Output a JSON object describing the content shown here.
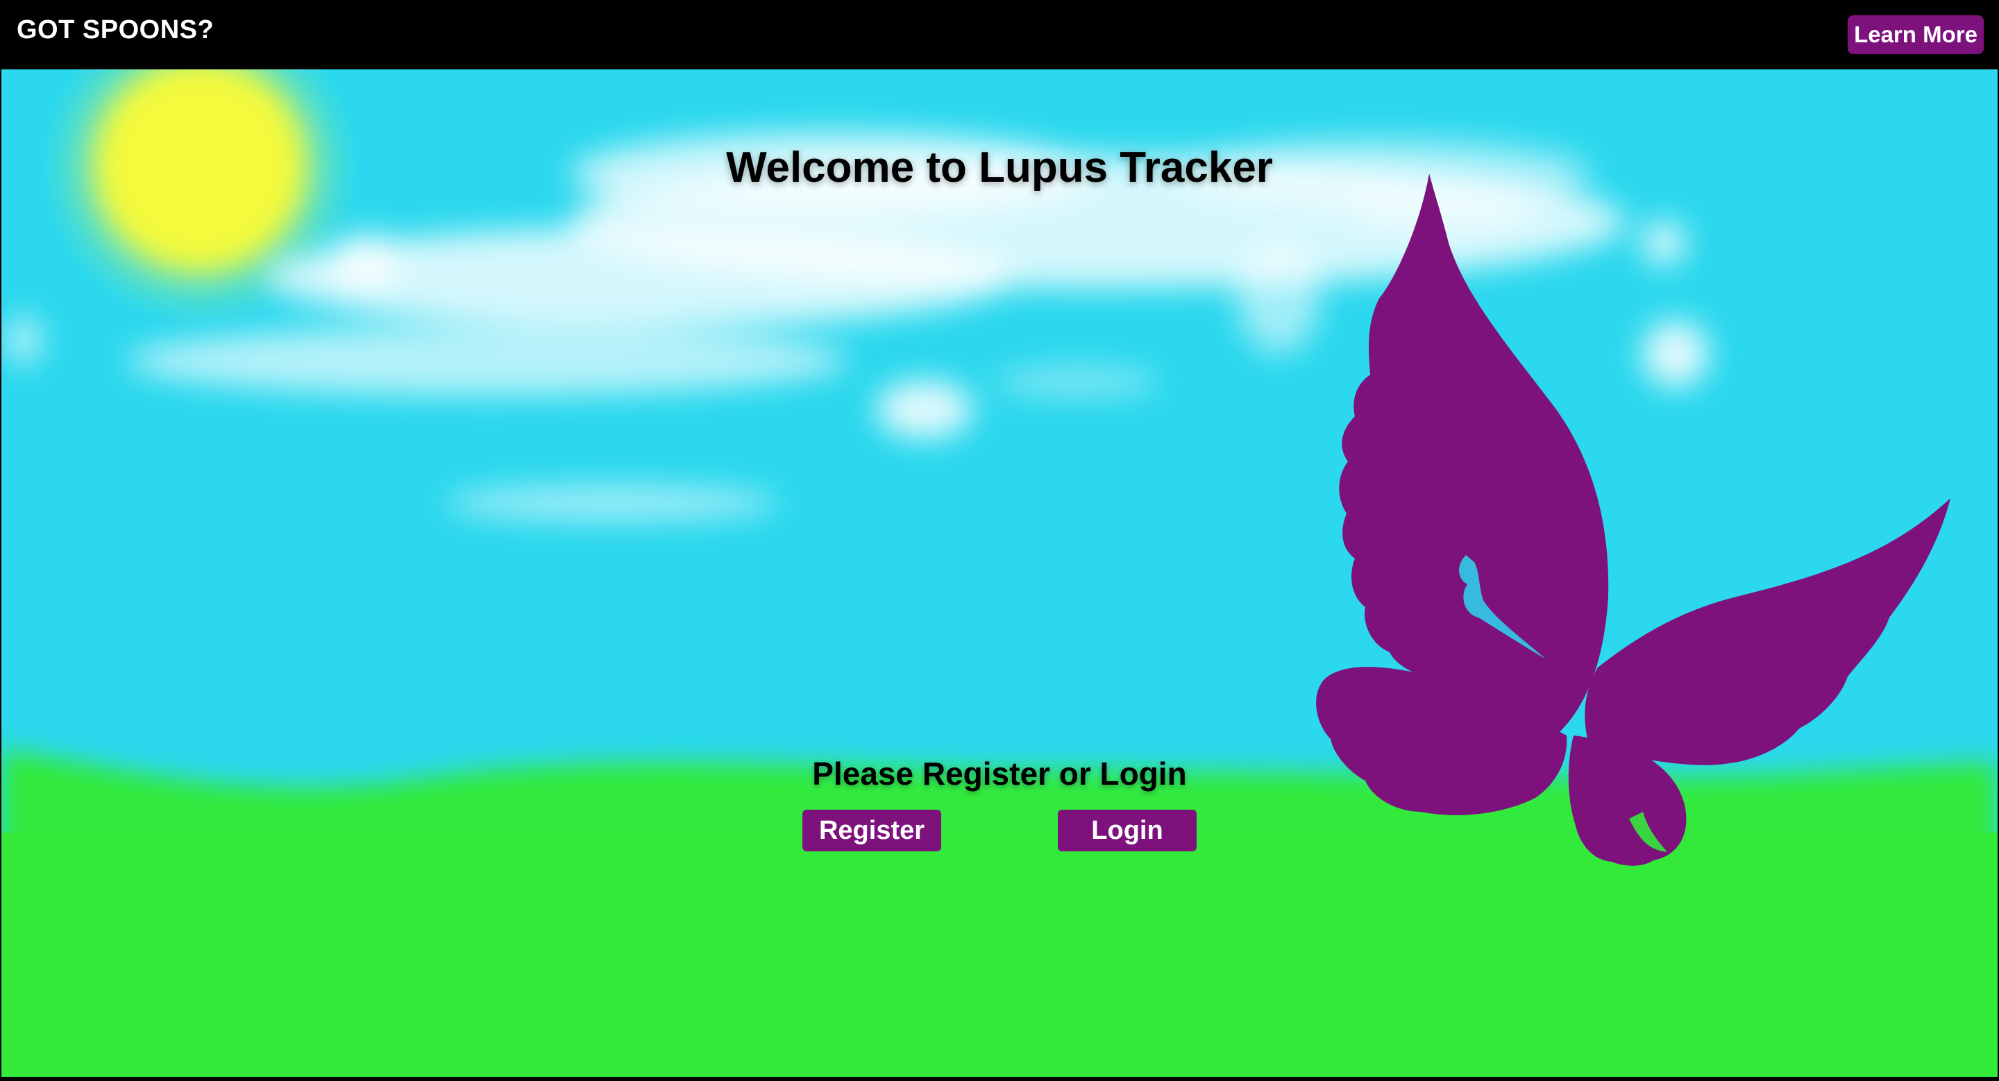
{
  "navbar": {
    "brand": "GOT SPOONS?",
    "learn_more_label": "Learn More"
  },
  "hero": {
    "title": "Welcome to Lupus Tracker",
    "prompt": "Please Register or Login",
    "register_label": "Register",
    "login_label": "Login",
    "illustration": [
      "sun",
      "clouds",
      "butterfly",
      "grass"
    ]
  },
  "colors": {
    "sky": "#2bd8ee",
    "grass": "#33ea3a",
    "sun": "#f6f93a",
    "butterfly": "#7d127d",
    "button": "#7d127d",
    "navbar": "#000000"
  }
}
